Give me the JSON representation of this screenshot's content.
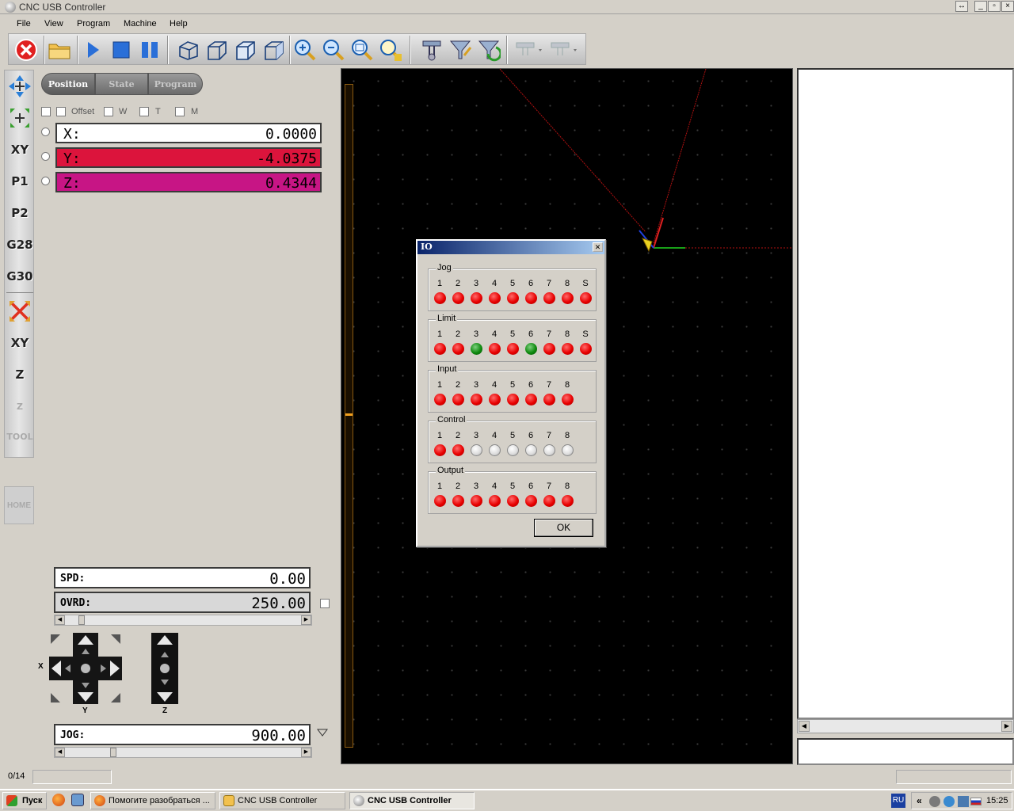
{
  "window": {
    "title": "CNC USB Controller"
  },
  "menu": [
    "File",
    "View",
    "Program",
    "Machine",
    "Help"
  ],
  "tabs": [
    "Position",
    "State",
    "Program"
  ],
  "checks": [
    "Offset",
    "W",
    "T",
    "M"
  ],
  "left_tools": {
    "labels": [
      "XY",
      "P1",
      "P2",
      "G28",
      "G30",
      "XY",
      "Z",
      "Z",
      "TOOL"
    ],
    "home": "HOME"
  },
  "dro": {
    "x": {
      "label": "X:",
      "value": "0.0000",
      "color": "#ffffff"
    },
    "y": {
      "label": "Y:",
      "value": "-4.0375",
      "color": "#dc143c"
    },
    "z": {
      "label": "Z:",
      "value": "0.4344",
      "color": "#c71585"
    }
  },
  "speed": {
    "spd_label": "SPD:",
    "spd_value": "0.00",
    "ovrd_label": "OVRD:",
    "ovrd_value": "250.00",
    "jog_label": "JOG:",
    "jog_value": "900.00"
  },
  "axis_labels": {
    "x": "X",
    "y": "Y",
    "z": "Z"
  },
  "status": {
    "counter": "0/14"
  },
  "io_dialog": {
    "title": "IO",
    "ok": "OK",
    "groups": [
      {
        "name": "Jog",
        "labels": [
          "1",
          "2",
          "3",
          "4",
          "5",
          "6",
          "7",
          "8",
          "S"
        ],
        "states": [
          "red",
          "red",
          "red",
          "red",
          "red",
          "red",
          "red",
          "red",
          "red"
        ]
      },
      {
        "name": "Limit",
        "labels": [
          "1",
          "2",
          "3",
          "4",
          "5",
          "6",
          "7",
          "8",
          "S"
        ],
        "states": [
          "red",
          "red",
          "green",
          "red",
          "red",
          "green",
          "red",
          "red",
          "red"
        ]
      },
      {
        "name": "Input",
        "labels": [
          "1",
          "2",
          "3",
          "4",
          "5",
          "6",
          "7",
          "8"
        ],
        "states": [
          "red",
          "red",
          "red",
          "red",
          "red",
          "red",
          "red",
          "red"
        ]
      },
      {
        "name": "Control",
        "labels": [
          "1",
          "2",
          "3",
          "4",
          "5",
          "6",
          "7",
          "8"
        ],
        "states": [
          "red",
          "red",
          "off",
          "off",
          "off",
          "off",
          "off",
          "off"
        ]
      },
      {
        "name": "Output",
        "labels": [
          "1",
          "2",
          "3",
          "4",
          "5",
          "6",
          "7",
          "8"
        ],
        "states": [
          "red",
          "red",
          "red",
          "red",
          "red",
          "red",
          "red",
          "red"
        ]
      }
    ]
  },
  "taskbar": {
    "start": "Пуск",
    "tasks": [
      "Помогите разобраться ...",
      "CNC USB Controller",
      "CNC USB Controller"
    ],
    "lang": "RU",
    "time": "15:25",
    "tray_chevron": "«"
  }
}
